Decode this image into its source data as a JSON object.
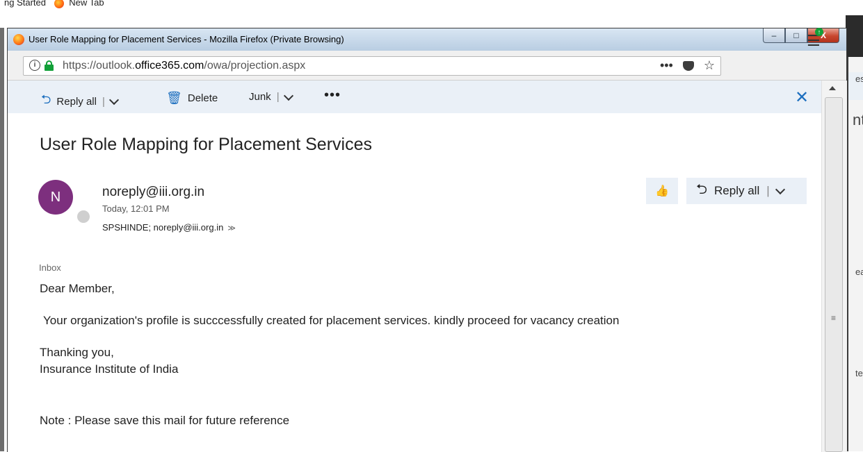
{
  "background": {
    "tab_fragment": "ng Started",
    "tab_newtab": "New Tab",
    "right_fragments": [
      "es",
      "nt",
      "eat",
      "te"
    ]
  },
  "window": {
    "title": "User Role Mapping for Placement Services - Mozilla Firefox (Private Browsing)",
    "buttons": {
      "minimize": "–",
      "maximize": "□",
      "close": "X"
    }
  },
  "address_bar": {
    "url_prefix": "https://outlook.",
    "url_domain": "office365.com",
    "url_suffix": "/owa/projection.aspx",
    "more_icon": "•••",
    "star_icon": "☆"
  },
  "toolbar": {
    "reply_all_label": "Reply all",
    "delete_label": "Delete",
    "junk_label": "Junk",
    "more_label": "•••",
    "close_label": "✕"
  },
  "message": {
    "subject": "User Role Mapping for Placement Services",
    "avatar_initial": "N",
    "sender": "noreply@iii.org.in",
    "timestamp": "Today, 12:01 PM",
    "recipients": "SPSHINDE; noreply@iii.org.in",
    "reply_all_label": "Reply all",
    "folder": "Inbox",
    "body": {
      "greeting": "Dear Member,",
      "paragraph": "Your organization's profile is succcessfully created for placement services. kindly proceed for vacancy creation",
      "closing": "Thanking you,",
      "signature": "Insurance Institute of India",
      "note": "Note : Please save this mail for future reference"
    }
  },
  "colors": {
    "accent": "#1d6fbf",
    "avatar": "#7d2f7e",
    "command_bar": "#eaf0f7",
    "secure_lock": "#12a038"
  }
}
